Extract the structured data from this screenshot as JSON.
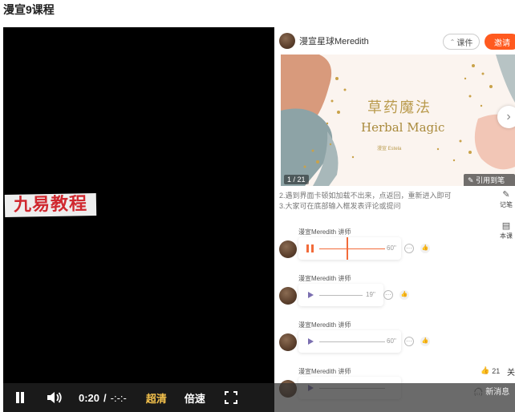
{
  "page": {
    "title": "漫宣9课程"
  },
  "video": {
    "watermark": "九易教程",
    "time_current": "0:20",
    "time_separator": "/",
    "time_total": "-:-:-",
    "quality_label": "超清",
    "speed_label": "倍速",
    "icons": [
      "pause-icon",
      "volume-icon",
      "fullscreen-icon"
    ]
  },
  "panel": {
    "teacher_name": "漫宣星球Meredith",
    "courseware_label": "课件",
    "invite_label": "邀请",
    "slide": {
      "title_cn": "草药魔法",
      "title_en": "Herbal Magic",
      "subtitle": "漫宣 Estela",
      "counter": "1 / 21",
      "cite_label": "引用到笔记"
    },
    "notice_lines": [
      "2.遇到界面卡顿如加载不出来，点返回，重新进入即可",
      "3.大家可在底部输入框发表评论或提问"
    ],
    "side_tools": [
      {
        "icon": "pencil-icon",
        "label": "记笔"
      },
      {
        "icon": "book-icon",
        "label": "本课"
      }
    ],
    "messages": [
      {
        "name": "漫宣Meredith 讲师",
        "duration": "60''",
        "state": "playing"
      },
      {
        "name": "漫宣Meredith 讲师",
        "duration": "19''",
        "state": "idle"
      },
      {
        "name": "漫宣Meredith 讲师",
        "duration": "60''",
        "state": "idle"
      },
      {
        "name": "漫宣Meredith 讲师",
        "duration": "",
        "state": "idle"
      }
    ],
    "likes_count": "21",
    "follow_label": "关",
    "new_message_label": "新消息"
  }
}
